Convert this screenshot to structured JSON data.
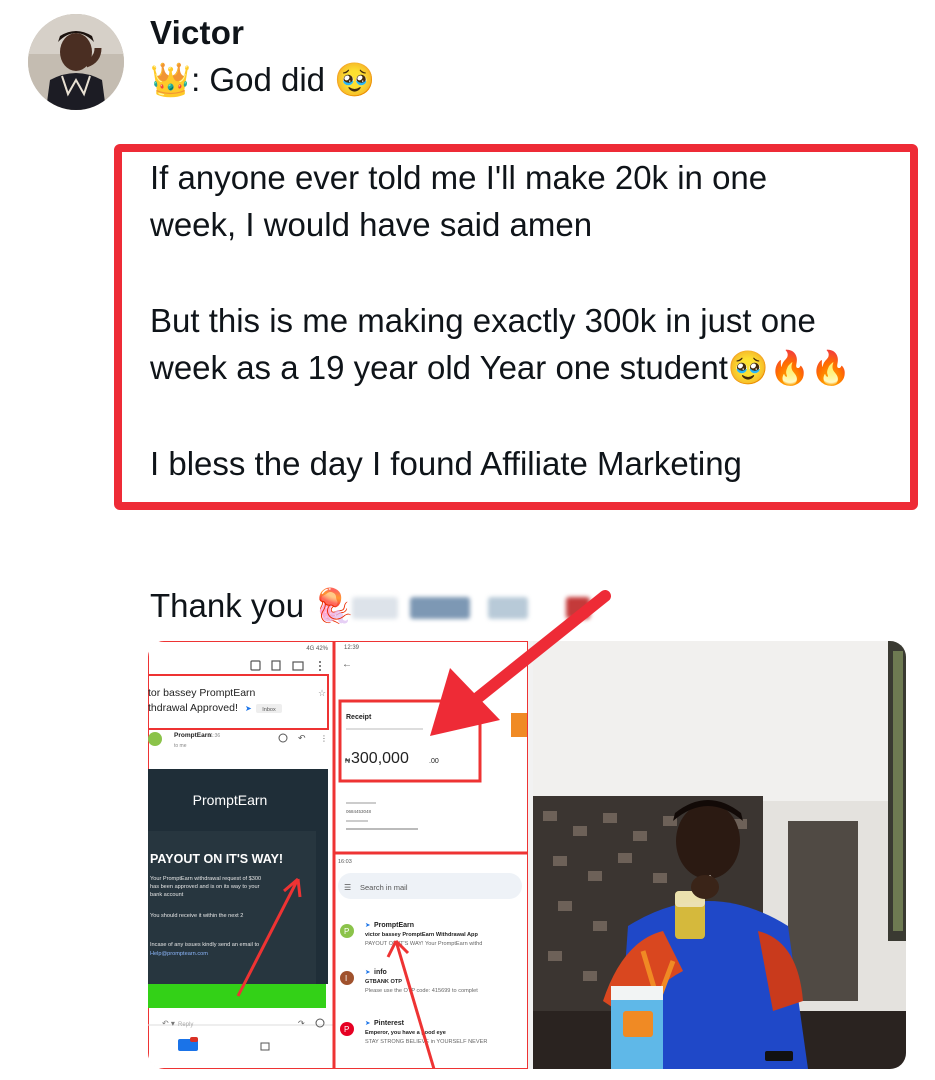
{
  "author": {
    "name": "Victor",
    "bio_text": ": God did",
    "bio_crown_emoji": "👑",
    "bio_end_emoji": "🥹"
  },
  "post": {
    "paragraphs": [
      "If anyone ever told me I'll make 20k in one\nweek, I would have said amen",
      "But this is me making exactly 300k in just one\nweek as a 19 year old Year one student🥹🔥🔥",
      "I bless the day I found Affiliate Marketing"
    ],
    "thanks_text": "Thank you",
    "thanks_emoji": "🪼"
  },
  "screenshot_left": {
    "email_subject_1": "tor bassey PromptEarn",
    "email_subject_2": "thdrawal Approved!",
    "inbox_badge": "Inbox",
    "sender": "PromptEarn",
    "sender_time": "11:36",
    "to_me": "to me",
    "brand": "PromptEarn",
    "payout_heading": "PAYOUT ON IT'S WAY!",
    "body_1": "Your PromptEarn withdrawal request of $300",
    "body_2": "has been approved and is on its way to your",
    "body_3": "bank account",
    "body_4": "You should receive it within the next 2",
    "body_5": "Incase of any issues kindly send an email to",
    "email_link": "Help@promptearn.com",
    "reply": "Reply",
    "status_bar": "4G 42%"
  },
  "screenshot_middle": {
    "time_top": "12:39",
    "receipt_label": "Receipt",
    "amount_main": "300,000",
    "amount_decimal": ".00",
    "currency": "₦",
    "account_number": "0684453048",
    "time_bottom": "16:03",
    "search_placeholder": "Search in mail",
    "mail_1_from": "PromptEarn",
    "mail_1_subject": "victor bassey PromptEarn Withdrawal App",
    "mail_1_preview": "PAYOUT ON IT'S WAY! Your PromptEarn withd",
    "mail_2_from": "info",
    "mail_2_subject": "GTBANK OTP",
    "mail_2_preview": "Please use the OTP code: 415699 to complet",
    "mail_3_from": "Pinterest",
    "mail_3_subject": "Emperor, you have a good eye",
    "mail_3_preview": "STAY STRONG BELIEVE in YOURSELF NEVER"
  },
  "colors": {
    "highlight_red": "#ee2b36",
    "text": "#0f1419",
    "email_dark": "#1f2e38",
    "button_green": "#33d117"
  }
}
